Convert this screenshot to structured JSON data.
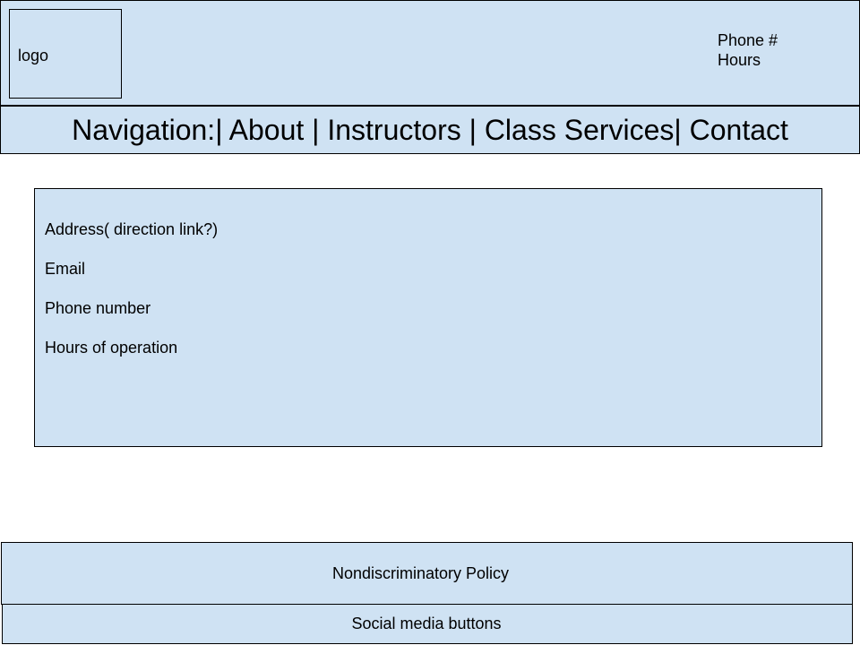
{
  "header": {
    "logo_label": "logo",
    "phone_label": "Phone #",
    "hours_label": "Hours"
  },
  "nav": {
    "text": "Navigation:| About | Instructors | Class Services| Contact"
  },
  "content": {
    "address": "Address( direction link?)",
    "email": "Email",
    "phone": "Phone number",
    "hours": "Hours of operation"
  },
  "footer": {
    "policy": "Nondiscriminatory Policy",
    "social": "Social media buttons"
  },
  "colors": {
    "panel_fill": "#cfe2f3",
    "border": "#000000"
  }
}
